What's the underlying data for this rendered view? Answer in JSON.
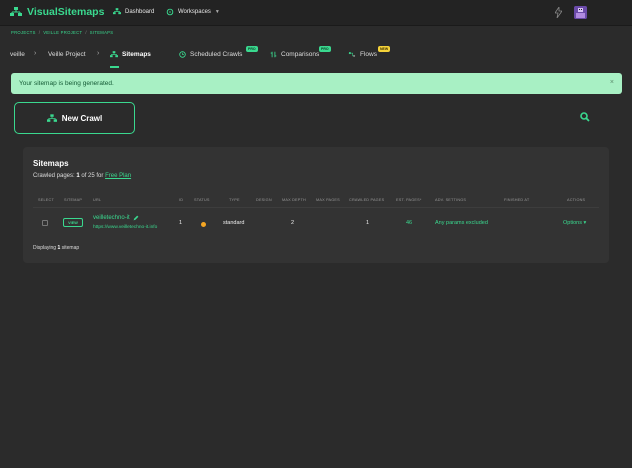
{
  "app": {
    "name": "VisualSitemaps"
  },
  "topnav": {
    "dashboard": "Dashboard",
    "workspaces": "Workspaces"
  },
  "breadcrumb": {
    "projects": "PROJECTS",
    "project": "VEILLE PROJECT",
    "current": "SITEMAPS"
  },
  "subnav": {
    "root": "veille",
    "project": "Veille Project",
    "sitemaps": "Sitemaps",
    "scheduled": "Scheduled Crawls",
    "scheduled_badge": "PRO",
    "comparisons": "Comparisons",
    "comparisons_badge": "PRO",
    "flows": "Flows",
    "flows_badge": "NEW"
  },
  "alert": {
    "message": "Your sitemap is being generated.",
    "close": "×"
  },
  "new_crawl": {
    "label": "New Crawl"
  },
  "sitemaps": {
    "title": "Sitemaps",
    "sub_prefix": "Crawled pages: ",
    "sub_count": "1",
    "sub_mid": " of 25 for ",
    "sub_plan": "Free Plan",
    "columns": {
      "select": "SELECT",
      "sitemap": "SITEMAP",
      "url": "URL",
      "id": "ID",
      "status": "STATUS",
      "type": "TYPE",
      "design": "DESIGN",
      "max_depth": "MAX DEPTH",
      "max_pages": "MAX PAGES",
      "crawled": "CRAWLED PAGES",
      "est": "EST. PAGES*",
      "adv": "ADV. SETTINGS",
      "finished": "FINISHED AT",
      "actions": "ACTIONS"
    },
    "row": {
      "view": "VIEW",
      "name": "veilletechno-it",
      "url": "https://www.veilletechno-it.info",
      "id": "1",
      "type": "standard",
      "max_depth": "2",
      "crawled": "1",
      "est": "46",
      "adv": "Any params excluded",
      "actions": "Options ▾"
    },
    "footer_prefix": "Displaying ",
    "footer_count": "1",
    "footer_suffix": " sitemap"
  },
  "colors": {
    "accent": "#3ad98f",
    "status": "#f5a623",
    "alert_bg": "#a8f0c4"
  }
}
